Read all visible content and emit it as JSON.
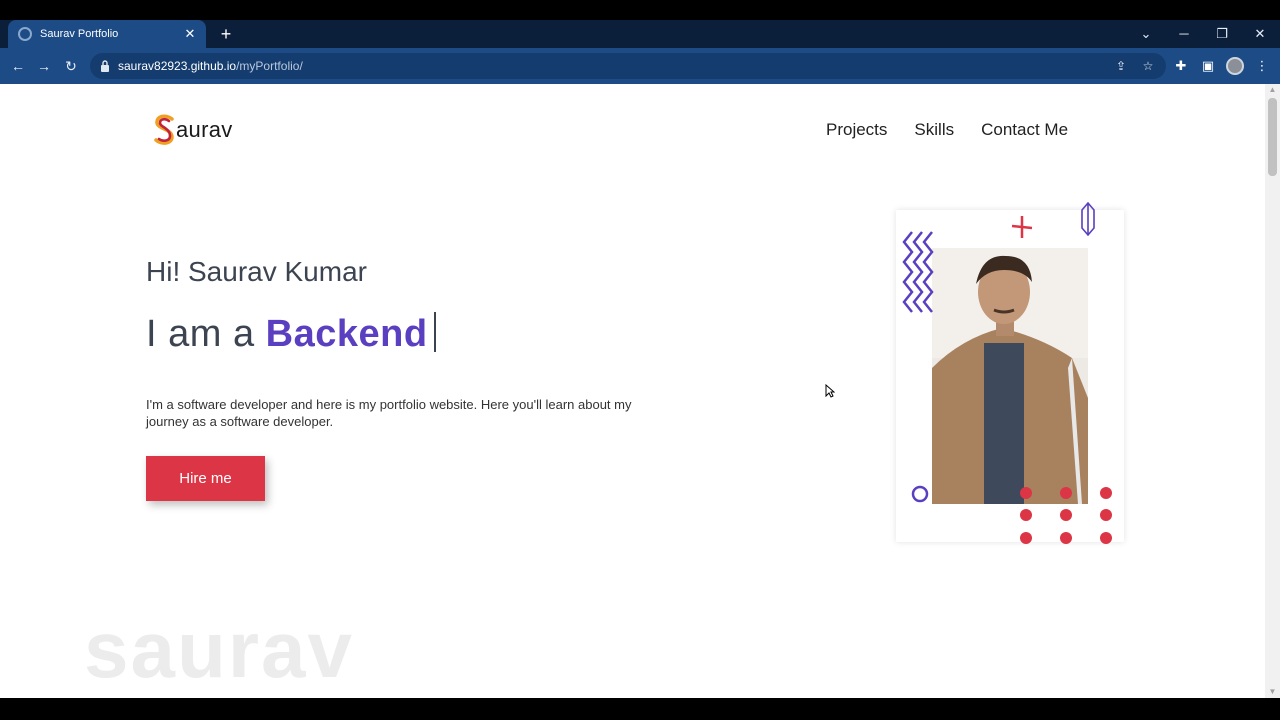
{
  "browser": {
    "tab_title": "Saurav Portfolio",
    "url_host": "saurav82923.github.io",
    "url_path": "/myPortfolio/",
    "new_tab_label": "+",
    "tab_close_label": "✕"
  },
  "site": {
    "logo_text": "aurav",
    "nav": [
      "Projects",
      "Skills",
      "Contact Me"
    ],
    "greeting": "Hi! Saurav Kumar",
    "iam_prefix": "I am a",
    "role": "Backend",
    "intro": "I'm a software developer and here is my portfolio website. Here you'll learn about my journey as a software developer.",
    "hire_label": "Hire me",
    "watermark": "saurav"
  },
  "colors": {
    "accent_purple": "#5a3fc0",
    "accent_red": "#dc3545",
    "browser_blue": "#1c4b86"
  },
  "icons": [
    "back-arrow-icon",
    "forward-arrow-icon",
    "reload-icon",
    "lock-icon",
    "share-icon",
    "star-icon",
    "extensions-icon",
    "sidebar-icon",
    "menu-icon"
  ]
}
